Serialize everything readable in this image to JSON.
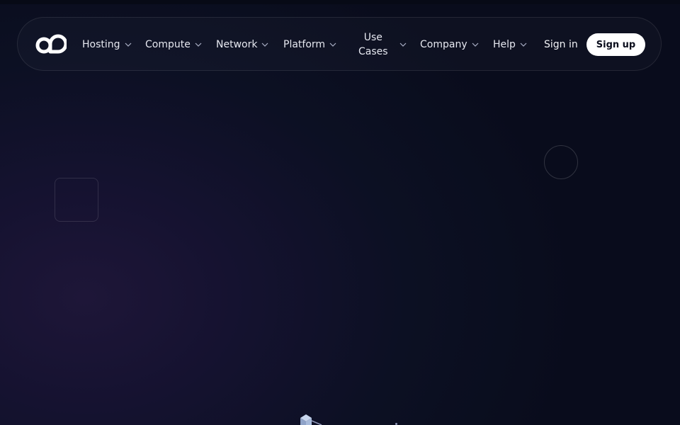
{
  "nav": {
    "logo_icon": "cloud-logo-icon",
    "items": [
      {
        "label": "Hosting",
        "icon": "chevron-down-icon"
      },
      {
        "label": "Compute",
        "icon": "chevron-down-icon"
      },
      {
        "label": "Network",
        "icon": "chevron-down-icon"
      },
      {
        "label": "Platform",
        "icon": "chevron-down-icon"
      },
      {
        "label_line1": "Use",
        "label_line2": "Cases",
        "icon": "chevron-down-icon"
      },
      {
        "label": "Company",
        "icon": "chevron-down-icon"
      },
      {
        "label": "Help",
        "icon": "chevron-down-icon"
      }
    ],
    "sign_in": "Sign in",
    "sign_up": "Sign up"
  },
  "colors": {
    "background": "#0c1023",
    "nav_text": "#e6e8f0",
    "signup_bg": "#ffffff",
    "signup_text": "#0a0d1c"
  }
}
